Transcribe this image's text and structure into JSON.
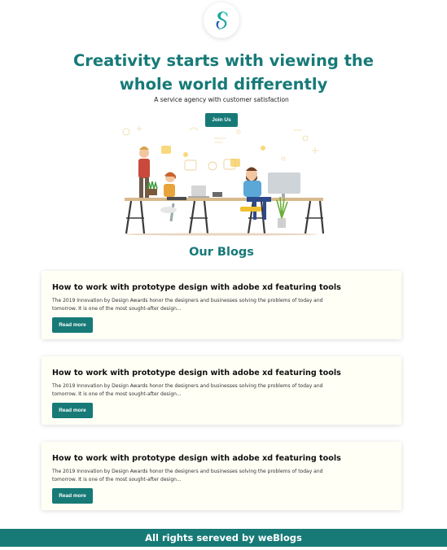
{
  "brand": {
    "logo_icon": "weblogs-logo-icon"
  },
  "hero": {
    "title_line1": "Creativity starts with viewing the",
    "title_line2": "whole world differently",
    "tagline": "A service agency with customer satisfaction",
    "join_label": "Join Us",
    "illustration_icon": "team-workspace-illustration"
  },
  "blogs": {
    "section_title": "Our Blogs",
    "items": [
      {
        "title": "How to work with prototype design with adobe xd featuring tools",
        "excerpt": "The 2019 Innovation by Design Awards honor the designers and businesses solving the problems of today and tomorrow. It is one of the most sought-after design...",
        "button_label": "Read more"
      },
      {
        "title": "How to work with prototype design with adobe xd featuring tools",
        "excerpt": "The 2019 Innovation by Design Awards honor the designers and businesses solving the problems of today and tomorrow. It is one of the most sought-after design...",
        "button_label": "Read more"
      },
      {
        "title": "How to work with prototype design with adobe xd featuring tools",
        "excerpt": "The 2019 Innovation by Design Awards honor the designers and businesses solving the problems of today and tomorrow. It is one of the most sought-after design...",
        "button_label": "Read more"
      }
    ]
  },
  "footer": {
    "text": "All rights sereved by weBlogs"
  },
  "colors": {
    "accent": "#177a77",
    "card_bg": "#fffff6"
  }
}
